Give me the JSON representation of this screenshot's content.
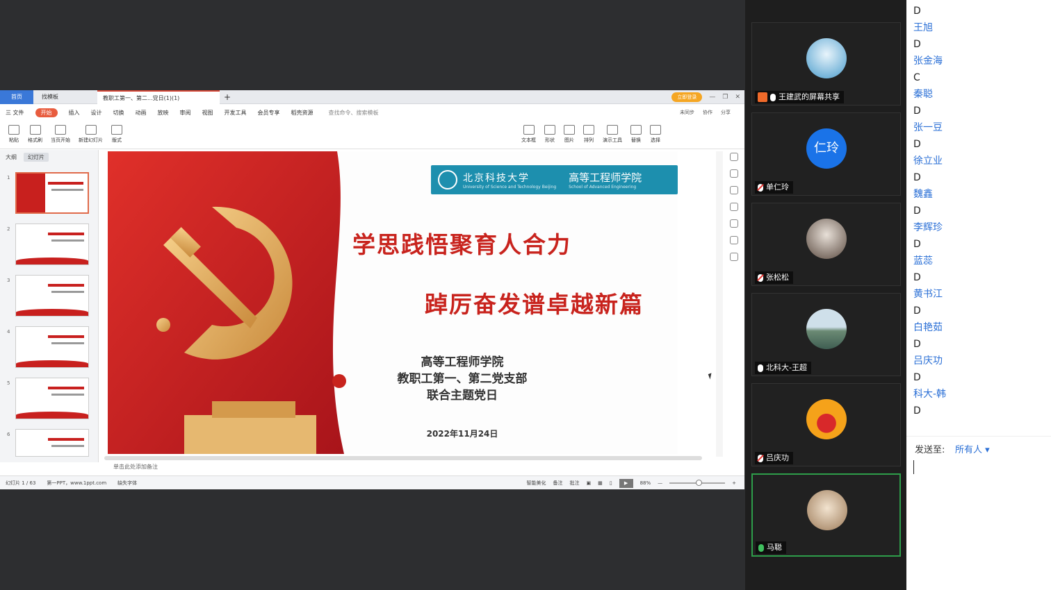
{
  "wps": {
    "tabs": {
      "home": "首页",
      "doc": "找模板",
      "ppt": "教职工第一、第二...党日(1)(1)",
      "plus": "+"
    },
    "login": "立即登录",
    "menu": [
      "三 文件",
      "开始",
      "插入",
      "设计",
      "切换",
      "动画",
      "放映",
      "审阅",
      "视图",
      "开发工具",
      "会员专享",
      "稻壳资源"
    ],
    "menu_active_index": 1,
    "search_placeholder": "查找命令、搜索模板",
    "menu_right": [
      "未同步",
      "协作",
      "分享"
    ],
    "toolbar": [
      "粘贴",
      "格式刷",
      "当页开始",
      "新建幻灯片",
      "版式",
      "文本框",
      "形状",
      "图片",
      "排列",
      "演示工具",
      "替换",
      "选择"
    ],
    "panel_tabs": [
      "大纲",
      "幻灯片"
    ],
    "thumb_numbers": [
      "1",
      "2",
      "3",
      "4",
      "5",
      "6"
    ],
    "notes_placeholder": "单击此处添加备注",
    "status": {
      "slide": "幻灯片 1 / 63",
      "theme": "第一PPT，www.1ppt.com",
      "font": "缺失字体",
      "smart": "智能美化",
      "notes": "备注",
      "comment": "批注",
      "zoom": "88%"
    }
  },
  "slide": {
    "university": "北京科技大学",
    "university_en": "University of Science and Technology Beijing",
    "school": "高等工程师学院",
    "school_en": "School of Advanced Engineering",
    "title1": "学思践悟聚育人合力",
    "title2": "踔厉奋发谱卓越新篇",
    "org_line1": "高等工程师学院",
    "org_line2": "教职工第一、第二党支部",
    "org_line3": "联合主题党日",
    "date": "2022年11月24日"
  },
  "participants": [
    {
      "name": "王建武的屏幕共享",
      "avatar_text": ""
    },
    {
      "name": "单仁玲",
      "avatar_text": "仁玲"
    },
    {
      "name": "张松松",
      "avatar_text": ""
    },
    {
      "name": "北科大-王超",
      "avatar_text": ""
    },
    {
      "name": "吕庆功",
      "avatar_text": ""
    },
    {
      "name": "马聪",
      "avatar_text": ""
    }
  ],
  "chat": {
    "messages": [
      "D",
      "王旭",
      "D",
      "张金海",
      "C",
      "秦聪",
      "D",
      "张一豆",
      "D",
      "徐立业",
      "D",
      "魏鑫",
      "D",
      "李辉珍",
      "D",
      "蓝蕊",
      "D",
      "黄书江",
      "D",
      "白艳茹",
      "D",
      "吕庆功",
      "D",
      "科大-韩",
      "D"
    ],
    "send_to_label": "发送至:",
    "send_target": "所有人 ▾"
  },
  "colors": {
    "accent": "#c8231d",
    "banner": "#1d8fae",
    "chat_name": "#2a6fd6",
    "active_speaker": "#2e9e4a"
  }
}
